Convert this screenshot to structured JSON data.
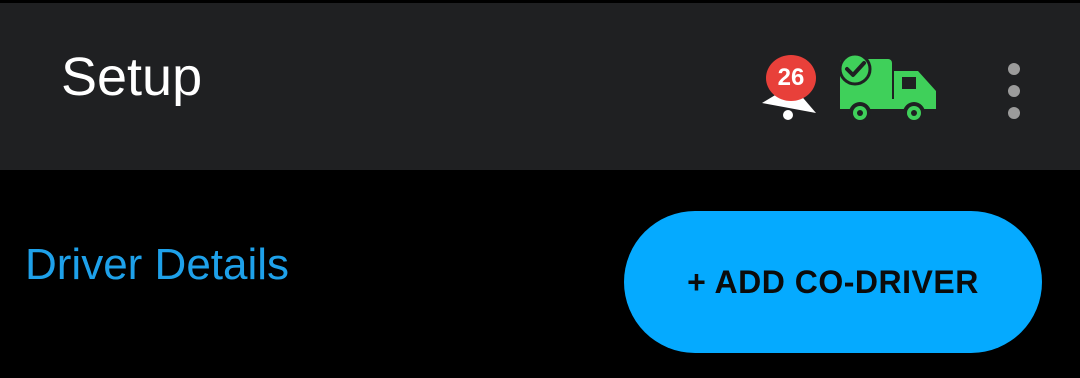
{
  "header": {
    "title": "Setup",
    "notification_count": "26",
    "icons": {
      "notifications": "bell-icon",
      "truck_status": "truck-check-icon",
      "menu": "more-vert-icon"
    }
  },
  "section": {
    "title": "Driver Details"
  },
  "actions": {
    "add_co_driver_label": "+ ADD CO-DRIVER"
  },
  "colors": {
    "header_bg": "#1f2022",
    "page_bg": "#000000",
    "accent_blue": "#05aaff",
    "section_title_blue": "#1ea1ea",
    "truck_green": "#3fd05a",
    "badge_red": "#e8403a"
  }
}
